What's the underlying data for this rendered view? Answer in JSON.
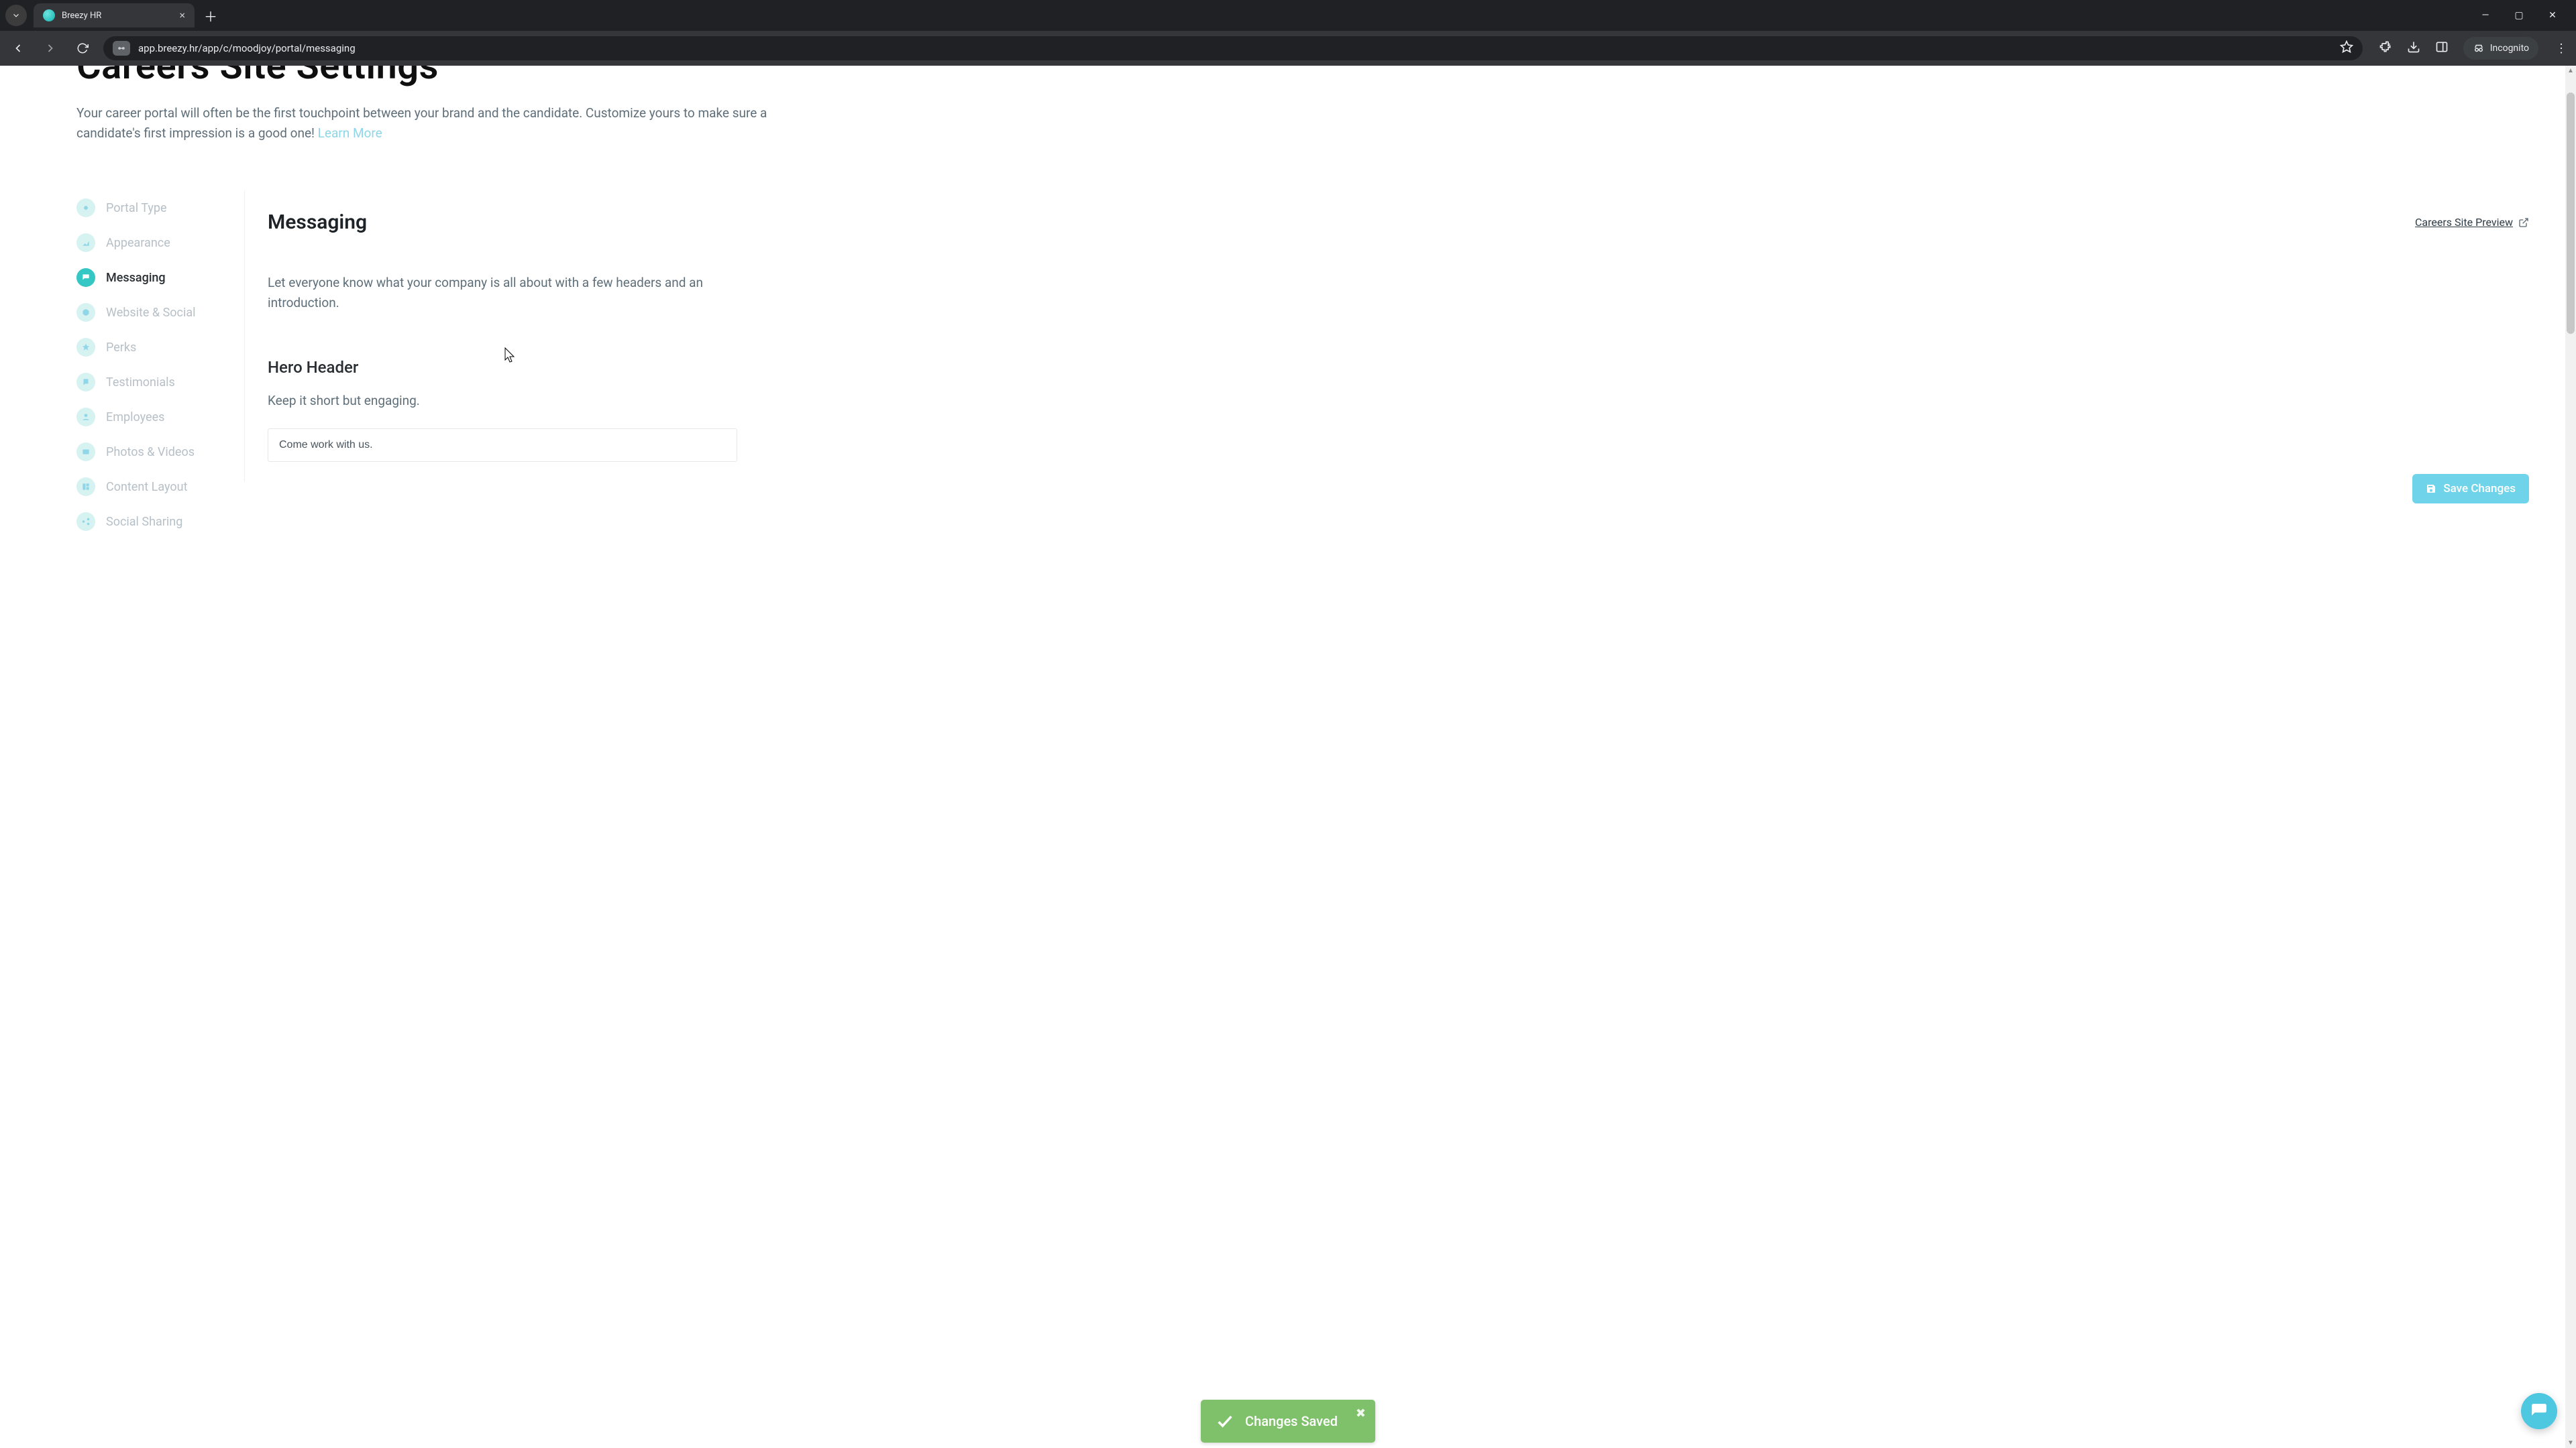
{
  "browser": {
    "tab_title": "Breezy HR",
    "url": "app.breezy.hr/app/c/moodjoy/portal/messaging",
    "incognito_label": "Incognito"
  },
  "page": {
    "title": "Careers Site Settings",
    "intro_text": "Your career portal will often be the first touchpoint between your brand and the candidate. Customize yours to make sure a candidate's first impression is a good one! ",
    "learn_more": "Learn More"
  },
  "sidebar": {
    "items": [
      {
        "label": "Portal Type"
      },
      {
        "label": "Appearance"
      },
      {
        "label": "Messaging"
      },
      {
        "label": "Website & Social"
      },
      {
        "label": "Perks"
      },
      {
        "label": "Testimonials"
      },
      {
        "label": "Employees"
      },
      {
        "label": "Photos & Videos"
      },
      {
        "label": "Content Layout"
      },
      {
        "label": "Social Sharing"
      }
    ],
    "active_index": 2
  },
  "panel": {
    "title": "Messaging",
    "preview_label": "Careers Site Preview",
    "intro": "Let everyone know what your company is all about with a few headers and an introduction.",
    "hero_section_title": "Hero Header",
    "hero_section_sub": "Keep it short but engaging.",
    "hero_input_value": "Come work with us."
  },
  "actions": {
    "save_label": "Save Changes",
    "toast_label": "Changes Saved"
  }
}
